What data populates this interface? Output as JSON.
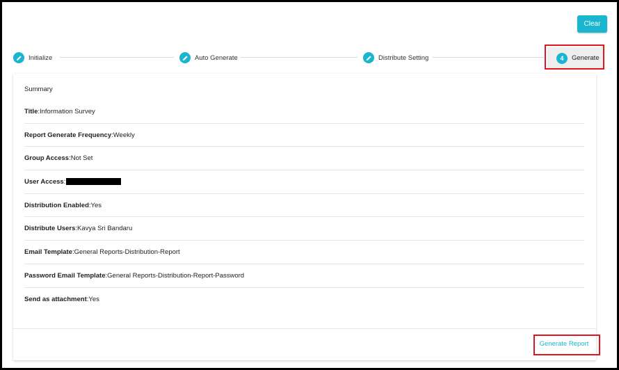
{
  "toolbar": {
    "clear_label": "Clear"
  },
  "stepper": {
    "steps": [
      {
        "label": "Initialize",
        "icon": "pencil-icon"
      },
      {
        "label": "Auto Generate",
        "icon": "pencil-icon"
      },
      {
        "label": "Distribute Setting",
        "icon": "pencil-icon"
      },
      {
        "label": "Generate",
        "number": "4"
      }
    ]
  },
  "summary": {
    "heading": "Summary",
    "rows": [
      {
        "key": "Title",
        "value": " Information Survey"
      },
      {
        "key": "Report Generate Frequency",
        "value": " Weekly"
      },
      {
        "key": "Group Access",
        "value": " Not Set"
      },
      {
        "key": "User Access",
        "value": ""
      },
      {
        "key": "Distribution Enabled",
        "value": " Yes"
      },
      {
        "key": "Distribute Users",
        "value": " Kavya Sri Bandaru"
      },
      {
        "key": "Email Template",
        "value": " General Reports-Distribution-Report"
      },
      {
        "key": "Password Email Template",
        "value": " General Reports-Distribution-Report-Password"
      },
      {
        "key": "Send as attachment",
        "value": " Yes"
      }
    ],
    "separator": ":"
  },
  "footer": {
    "generate_label": "Generate Report"
  },
  "colors": {
    "accent": "#1ab5cf",
    "highlight": "#e0161e"
  }
}
